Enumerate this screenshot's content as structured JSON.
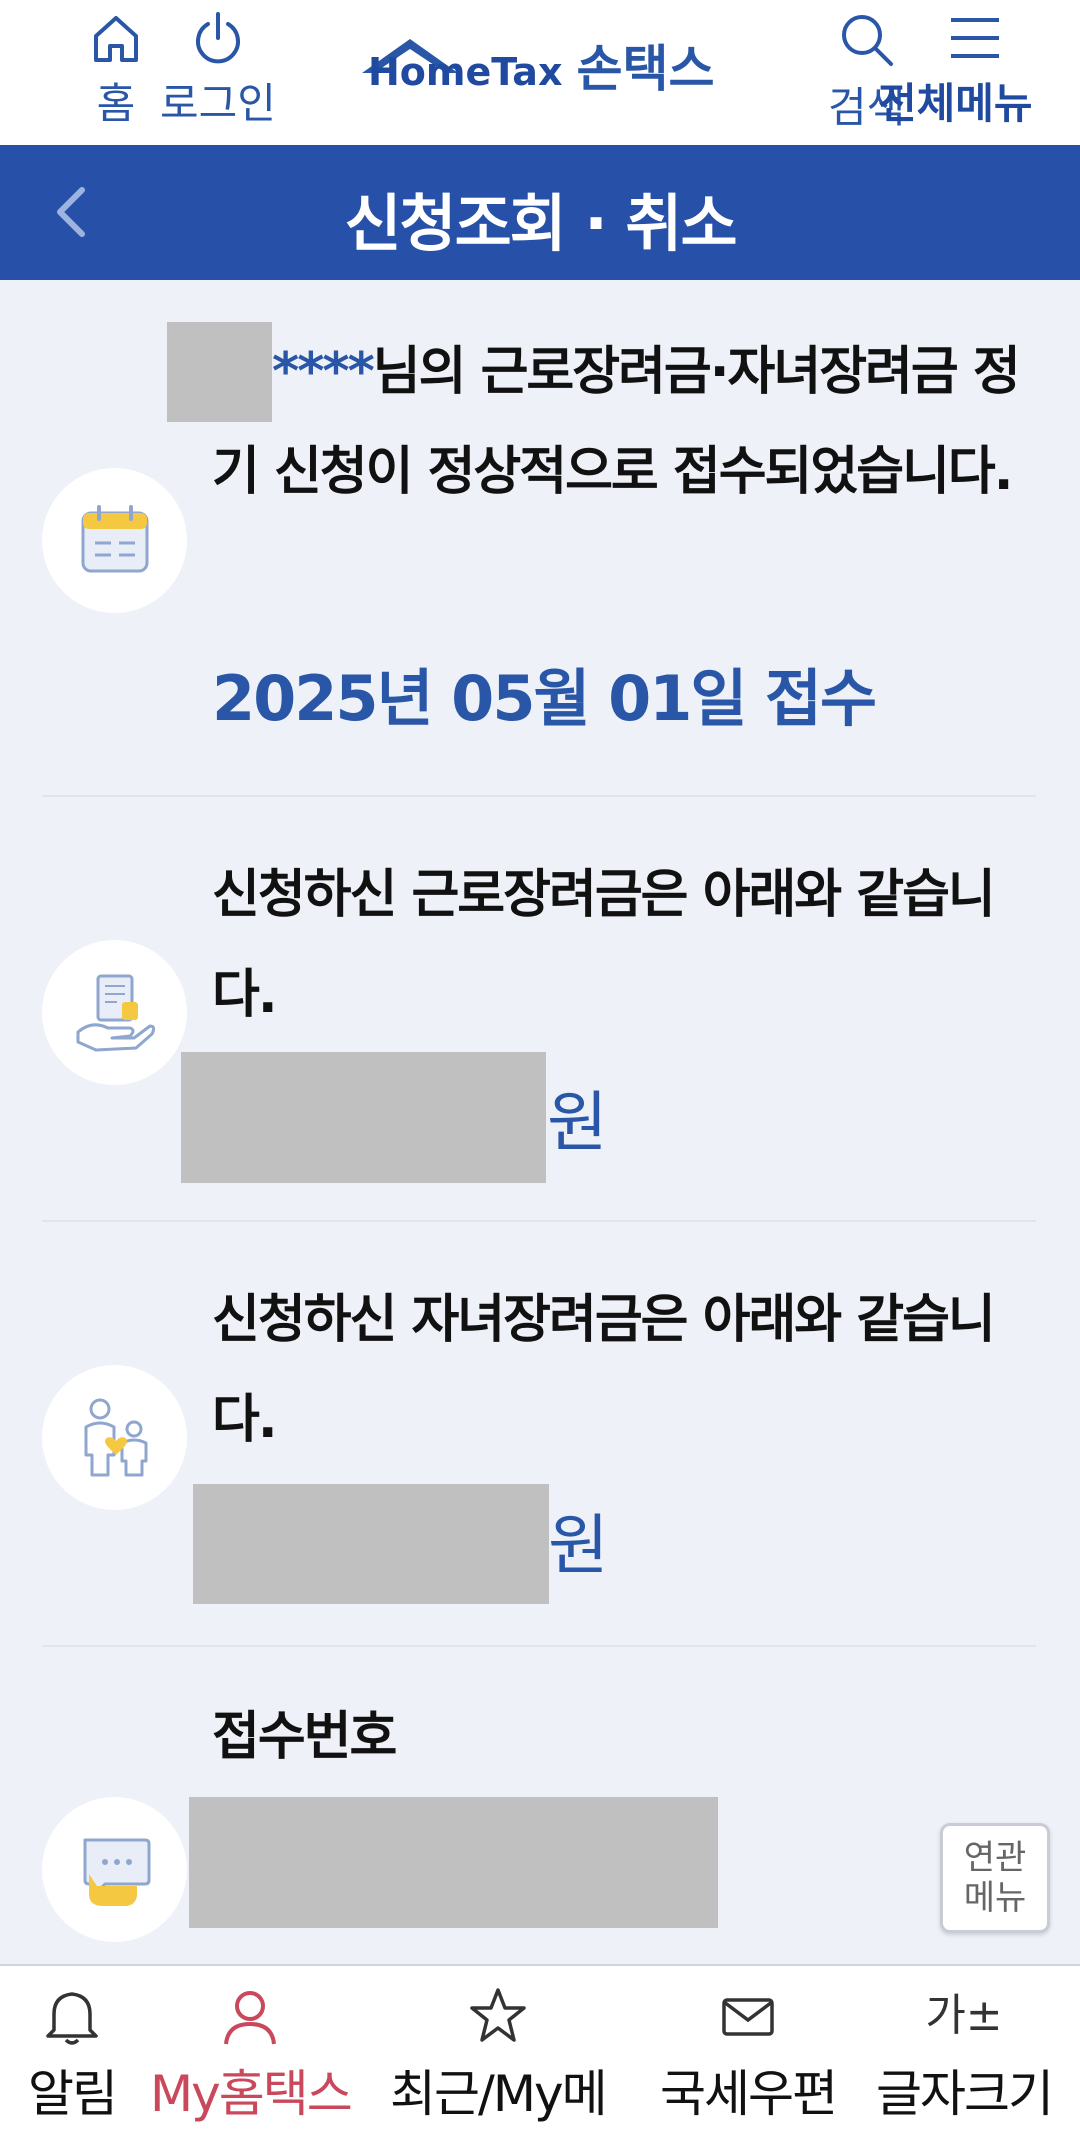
{
  "header": {
    "home_label": "홈",
    "login_label": "로그인",
    "logo_text": "HomeTax",
    "logo_sub": "손택스",
    "search_label": "검색",
    "menu_label": "전체메뉴"
  },
  "titlebar": {
    "title": "신청조회 · 취소"
  },
  "section1": {
    "stars": "****",
    "text_after_name": "님의 근로장려금·자녀장려금 정기 신청이 정상적으로 접수되었습니다.",
    "date": "2025년 05월 01일 접수"
  },
  "section2": {
    "text": "신청하신 근로장려금은 아래와 같습니다.",
    "unit": "원"
  },
  "section3": {
    "text": "신청하신 자녀장려금은 아래와 같습니다.",
    "unit": "원"
  },
  "section4": {
    "label": "접수번호"
  },
  "related_menu": {
    "line1": "연관",
    "line2": "메뉴"
  },
  "bottom_nav": {
    "alarm": "알림",
    "my": "My홈택스",
    "recent": "최근/My메",
    "mail": "국세우편",
    "font": "글자크기",
    "font_icon": "가±"
  },
  "colors": {
    "brand": "#2751a8",
    "accent_text": "#2a56a8",
    "my_active": "#c9485b",
    "background": "#eef1f7"
  }
}
